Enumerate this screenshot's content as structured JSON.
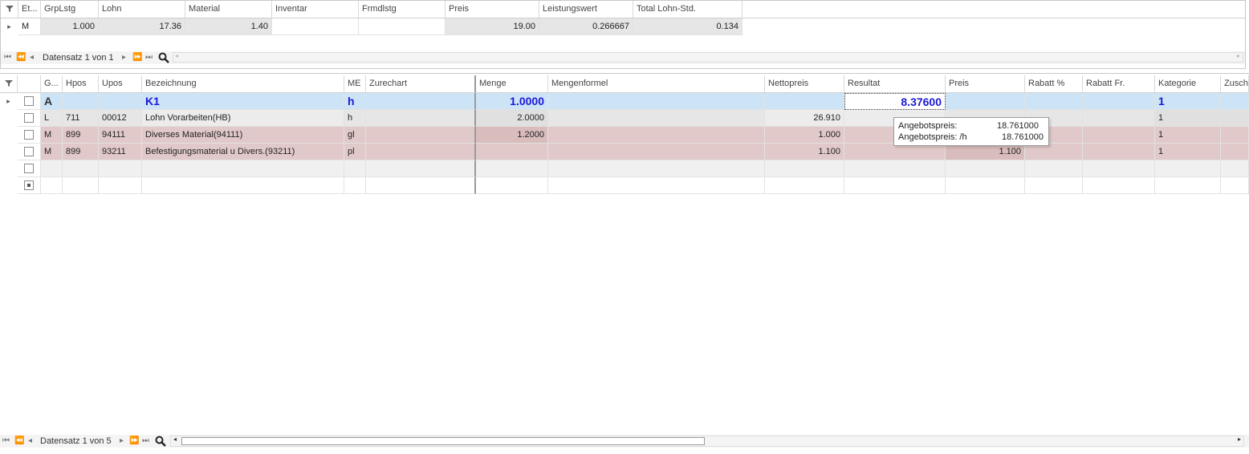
{
  "top_grid": {
    "columns": [
      "Et...",
      "GrpLstg",
      "Lohn",
      "Material",
      "Inventar",
      "Frmdlstg",
      "Preis",
      "Leistungswert",
      "Total Lohn-Std."
    ],
    "row": [
      "M",
      "1.000",
      "17.36",
      "1.40",
      "",
      "",
      "19.00",
      "0.266667",
      "0.134"
    ],
    "nav_text": "Datensatz 1 von 1"
  },
  "bottom_grid": {
    "columns": [
      "G...",
      "Hpos",
      "Upos",
      "Bezeichnung",
      "ME",
      "Zurechart",
      "Menge",
      "Mengenformel",
      "Nettopreis",
      "Resultat",
      "Preis",
      "Rabatt %",
      "Rabatt Fr.",
      "Kategorie",
      "Zusch"
    ],
    "rows": [
      [
        "A",
        "",
        "",
        "K1",
        "h",
        "",
        "1.0000",
        "",
        "",
        "8.37600",
        "",
        "",
        "",
        "1",
        ""
      ],
      [
        "L",
        "711",
        "00012",
        "Lohn Vorarbeiten(HB)",
        "h",
        "",
        "2.0000",
        "",
        "26.910",
        "",
        "",
        "",
        "",
        "1",
        ""
      ],
      [
        "M",
        "899",
        "94111",
        "Diverses Material(94111)",
        "gl",
        "",
        "1.2000",
        "",
        "1.000",
        "",
        "",
        "",
        "",
        "1",
        ""
      ],
      [
        "M",
        "899",
        "93211",
        "Befestigungsmaterial u Divers.(93211)",
        "pl",
        "",
        "",
        "",
        "1.100",
        "",
        "1.100",
        "",
        "",
        "1",
        ""
      ],
      [
        "",
        "",
        "",
        "",
        "",
        "",
        "",
        "",
        "",
        "",
        "",
        "",
        "",
        "",
        ""
      ],
      [
        "",
        "",
        "",
        "",
        "",
        "",
        "",
        "",
        "",
        "",
        "",
        "",
        "",
        "",
        ""
      ]
    ],
    "nav_text": "Datensatz 1 von 5"
  },
  "tooltip": {
    "line1_label": "Angebotspreis:",
    "line1_value": "18.761000",
    "line2_label": "Angebotspreis: /h",
    "line2_value": "18.761000"
  },
  "colors": {
    "selected_row": "#cde4f7",
    "labor_row": "#e6e6e6",
    "material_row": "#e2c9c9",
    "accent_text": "#1a1ad6"
  },
  "icons": [
    "filter-icon",
    "first-icon",
    "prev-page-icon",
    "prev-icon",
    "next-icon",
    "next-page-icon",
    "last-icon",
    "search-icon",
    "row-indicator-icon"
  ]
}
